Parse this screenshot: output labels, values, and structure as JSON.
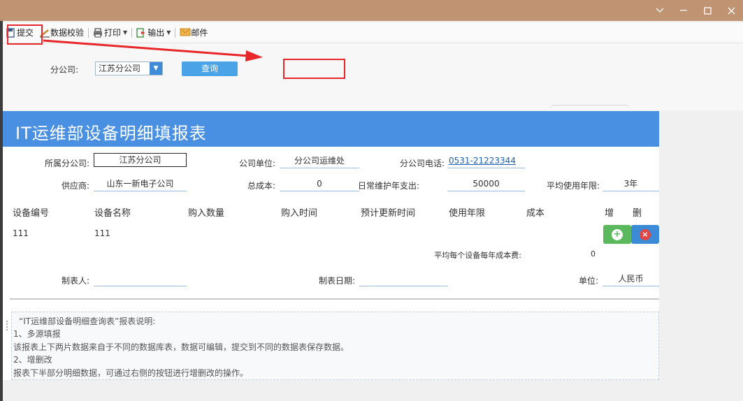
{
  "toolbar": {
    "submit_label": "提交",
    "validate_label": "数据校验",
    "print_label": "打印",
    "export_label": "输出",
    "mail_label": "邮件"
  },
  "filter": {
    "label": "分公司:",
    "selected": "江苏分公司",
    "query_button": "查询"
  },
  "report": {
    "title": "IT运维部设备明细填报表",
    "fields": {
      "branch_label": "所属分公司:",
      "branch_value": "江苏分公司",
      "unit_label": "公司单位:",
      "unit_value": "分公司运维处",
      "phone_label": "分公司电话:",
      "phone_value": "0531-21223344",
      "supplier_label": "供应商:",
      "supplier_value": "山东一新电子公司",
      "total_cost_label": "总成本:",
      "total_cost_value": "0",
      "maintenance_label": "日常维护年支出:",
      "maintenance_value": "50000",
      "avg_years_label": "平均使用年限:",
      "avg_years_value": "3年"
    },
    "columns": [
      "设备编号",
      "设备名称",
      "购入数量",
      "购入时间",
      "预计更新时间",
      "使用年限",
      "成本",
      "增",
      "删"
    ],
    "rows": [
      {
        "device_no": "111",
        "device_name": "111"
      }
    ],
    "avg_cost_label": "平均每个设备每年成本费:",
    "avg_cost_value": "0",
    "maker_label": "制表人:",
    "maker_value": "",
    "date_label": "制表日期:",
    "date_value": "",
    "currency_label": "单位:",
    "currency_value": "人民币"
  },
  "notes": {
    "lines": [
      "“IT运维部设备明细查询表”报表说明:",
      "1、多源填报",
      "该报表上下两片数据来自于不同的数据库表，数据可编辑，提交到不同的数据表保存数据。",
      "2、增删改",
      "报表下半部分明细数据，可通过右侧的按钮进行增删改的操作。"
    ]
  },
  "colors": {
    "header_blue": "#4a90e2",
    "add_green": "#5cb85c",
    "delete_red": "#e04848",
    "annotation_red": "#e8272a"
  }
}
